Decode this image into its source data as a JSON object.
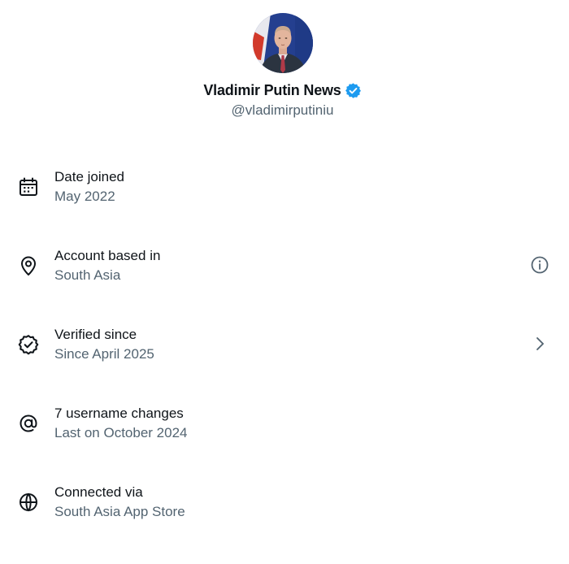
{
  "profile": {
    "display_name": "Vladimir Putin News",
    "handle": "@vladimirputiniu",
    "avatar_icon": "profile-photo",
    "verified_icon": "verified-badge-icon",
    "verified_color": "#1d9bf0"
  },
  "colors": {
    "primary_text": "#0f1419",
    "secondary_text": "#536471"
  },
  "rows": [
    {
      "title": "Date joined",
      "value": "May 2022",
      "icon": "calendar-icon"
    },
    {
      "title": "Account based in",
      "value": "South Asia",
      "icon": "location-pin-icon",
      "trailing_icon": "info-icon"
    },
    {
      "title": "Verified since",
      "value": "Since April 2025",
      "icon": "verified-seal-icon",
      "trailing_icon": "chevron-right-icon"
    },
    {
      "title": "7 username changes",
      "value": "Last on October 2024",
      "icon": "at-sign-icon"
    },
    {
      "title": "Connected via",
      "value": "South Asia App Store",
      "icon": "globe-icon"
    }
  ]
}
